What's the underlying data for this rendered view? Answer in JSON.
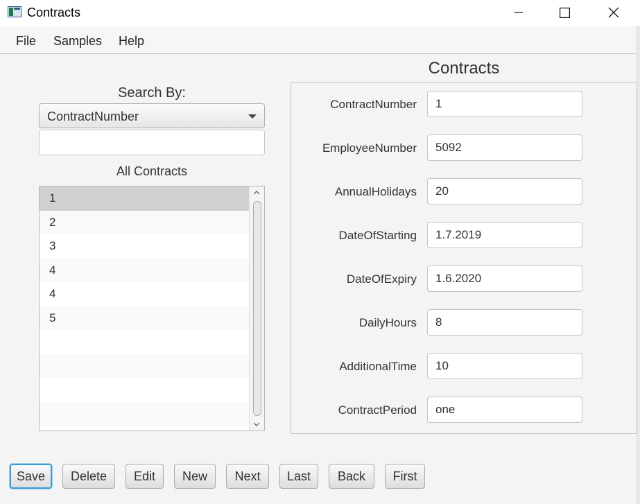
{
  "window": {
    "title": "Contracts"
  },
  "menu": {
    "items": [
      "File",
      "Samples",
      "Help"
    ]
  },
  "search": {
    "label": "Search By:",
    "selected_field": "ContractNumber",
    "query": ""
  },
  "list": {
    "heading": "All Contracts",
    "items": [
      "1",
      "2",
      "3",
      "4",
      "4",
      "5",
      "",
      "",
      "",
      ""
    ],
    "selected_index": 0
  },
  "details": {
    "title": "Contracts",
    "fields": [
      {
        "label": "ContractNumber",
        "value": "1"
      },
      {
        "label": "EmployeeNumber",
        "value": "5092"
      },
      {
        "label": "AnnualHolidays",
        "value": "20"
      },
      {
        "label": "DateOfStarting",
        "value": "1.7.2019"
      },
      {
        "label": "DateOfExpiry",
        "value": "1.6.2020"
      },
      {
        "label": "DailyHours",
        "value": "8"
      },
      {
        "label": "AdditionalTime",
        "value": "10"
      },
      {
        "label": "ContractPeriod",
        "value": "one"
      }
    ]
  },
  "buttons": {
    "save": "Save",
    "delete": "Delete",
    "edit": "Edit",
    "new": "New",
    "next": "Next",
    "last": "Last",
    "back": "Back",
    "first": "First"
  },
  "colors": {
    "focus_ring": "#3c9bd6",
    "selected_row": "#d0d0d0"
  }
}
